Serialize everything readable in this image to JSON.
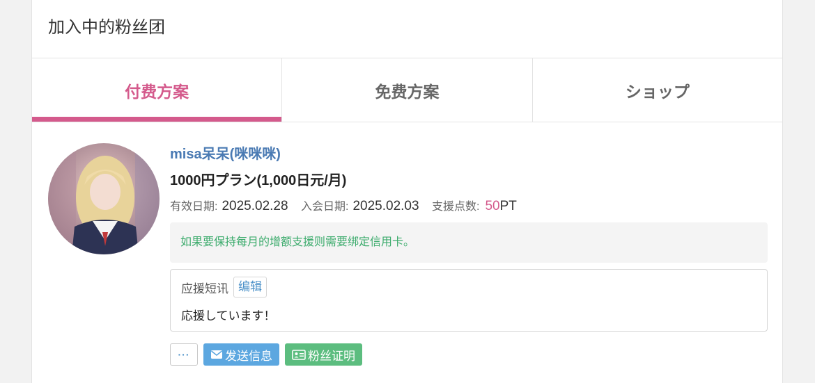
{
  "panel": {
    "title": "加入中的粉丝团"
  },
  "tabs": [
    {
      "label": "付费方案",
      "active": true
    },
    {
      "label": "免费方案",
      "active": false
    },
    {
      "label": "ショップ",
      "active": false
    }
  ],
  "membership": {
    "creator_name": "misa呆呆(咪咪咪)",
    "plan": "1000円プラン(1,000日元/月)",
    "valid_label": "有效日期:",
    "valid_date": "2025.02.28",
    "join_label": "入会日期:",
    "join_date": "2025.02.03",
    "points_label": "支援点数:",
    "points_value": "50",
    "points_unit": "PT",
    "notice": "如果要保持每月的增额支援则需要绑定信用卡。",
    "message_label": "应援短讯",
    "edit_label": "编辑",
    "message_text": "応援しています！"
  },
  "actions": {
    "more_label": "···",
    "send_label": "发送信息",
    "proof_label": "粉丝证明"
  },
  "colors": {
    "accent": "#d45a8c",
    "link": "#4a7ab3",
    "notice": "#3cab6c",
    "send_button": "#5ca7e0",
    "proof_button": "#5cbd7f"
  }
}
